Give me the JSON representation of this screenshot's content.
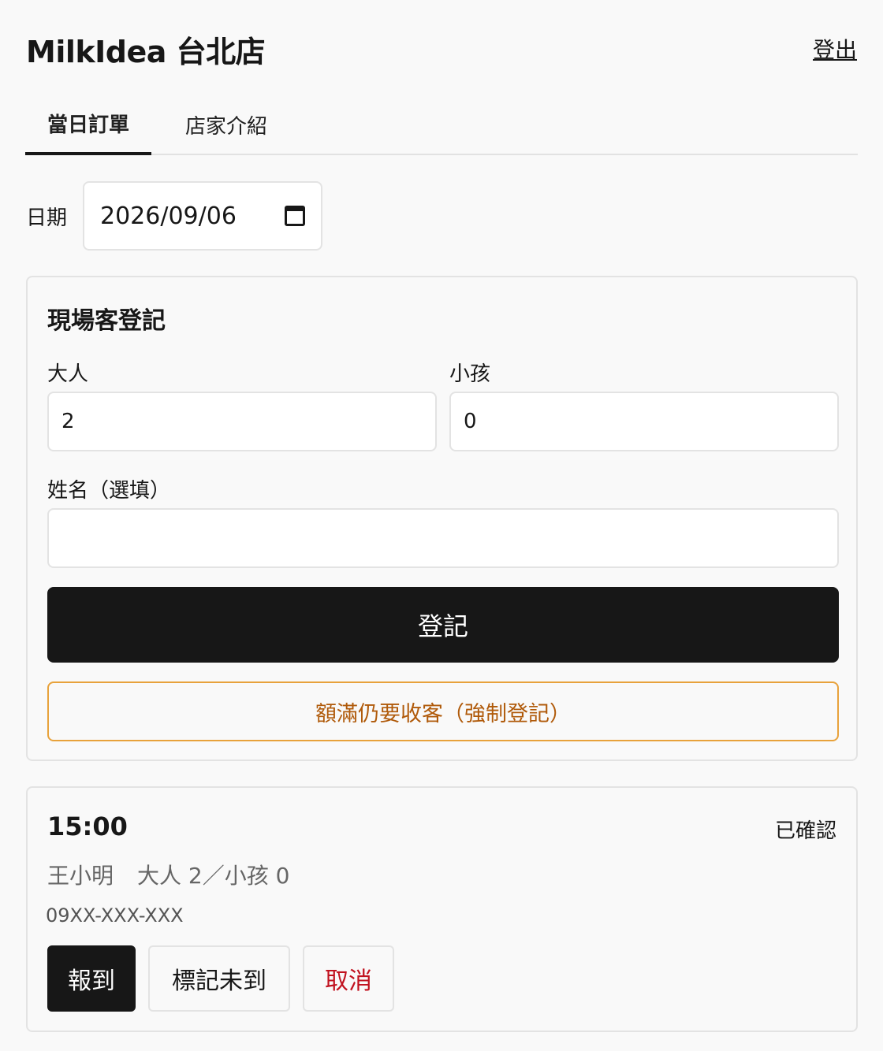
{
  "header": {
    "title": "MilkIdea 台北店",
    "logout": "登出"
  },
  "tabs": [
    {
      "label": "當日訂單"
    },
    {
      "label": "店家介紹"
    }
  ],
  "date": {
    "label": "日期",
    "value": "2026/09/06"
  },
  "walkin": {
    "title": "現場客登記",
    "adults_label": "大人",
    "adults_value": "2",
    "children_label": "小孩",
    "children_value": "0",
    "name_label": "姓名（選填）",
    "name_value": "",
    "submit_label": "登記",
    "force_label": "額滿仍要收客（強制登記）"
  },
  "orders": [
    {
      "time": "15:00",
      "status": "已確認",
      "name": "王小明",
      "party": "大人 2／小孩 0",
      "phone": "09XX-XXX-XXX",
      "actions": {
        "checkin": "報到",
        "noshow": "標記未到",
        "cancel": "取消"
      }
    }
  ]
}
